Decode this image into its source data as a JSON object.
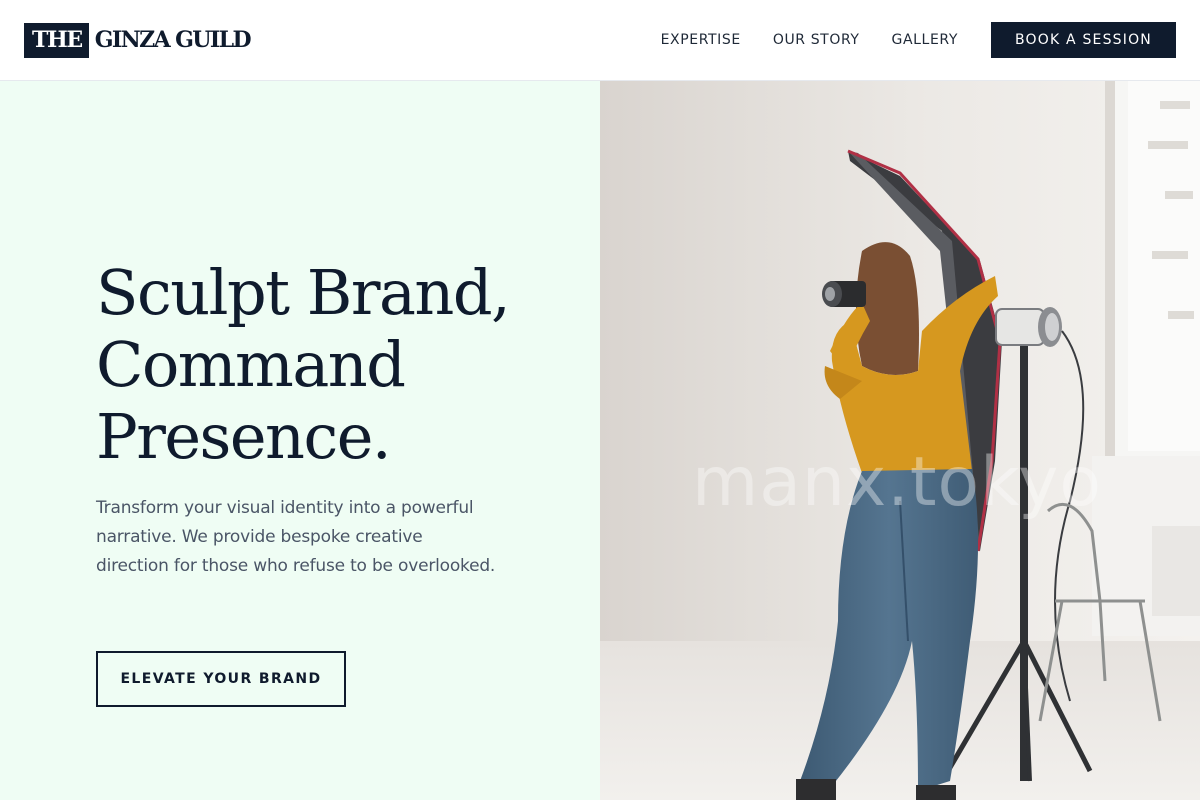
{
  "brand": {
    "logo_box": "THE",
    "logo_text": "GINZA GUILD"
  },
  "nav": {
    "links": [
      "EXPERTISE",
      "OUR STORY",
      "GALLERY"
    ],
    "cta": "BOOK A SESSION"
  },
  "hero": {
    "headline_lines": [
      "Sculpt Brand,",
      "Command",
      "Presence."
    ],
    "subtext": "Transform your visual identity into a powerful narrative. We provide bespoke creative direction for those who refuse to be overlooked.",
    "cta": "ELEVATE YOUR BRAND"
  },
  "image": {
    "watermark": "manx.tokyo"
  },
  "colors": {
    "navy": "#0f1b2d",
    "mint_panel": "#effdf4",
    "body_text": "#4a5566"
  }
}
